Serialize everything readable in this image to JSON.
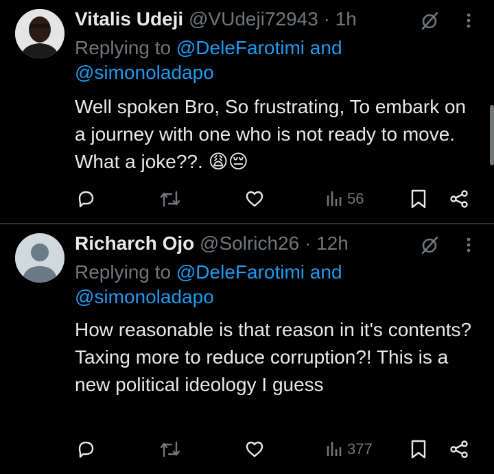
{
  "tweets": [
    {
      "name": "Vitalis Udeji",
      "handle": "@VUdeji72943",
      "separator": "·",
      "time": "1h",
      "replying_prefix": "Replying to",
      "mention_1": "@DeleFarotimi",
      "and_word": "and",
      "mention_2": "@simonoladapo",
      "text": "Well spoken Bro, So frustrating, To embark on a journey with one who is not ready to move. What a joke??. 😩😔",
      "views": "56"
    },
    {
      "name": "Richarch Ojo",
      "handle": "@Solrich26",
      "separator": "·",
      "time": "12h",
      "replying_prefix": "Replying to",
      "mention_1": "@DeleFarotimi",
      "and_word": "and",
      "mention_2": "@simonoladapo",
      "text": "How reasonable is that reason in it's contents? Taxing more to reduce corruption?! This is a new political ideology I guess",
      "views": "377"
    }
  ],
  "icons": {
    "reply": "reply-icon",
    "retweet": "retweet-icon",
    "like": "like-icon",
    "views": "views-icon",
    "bookmark": "bookmark-icon",
    "share": "share-icon",
    "grok": "grok-icon",
    "more": "more-icon"
  },
  "colors": {
    "background": "#000000",
    "text": "#e7e9ea",
    "secondary": "#71767b",
    "link": "#1d9bf0",
    "divider": "#2f3336"
  }
}
